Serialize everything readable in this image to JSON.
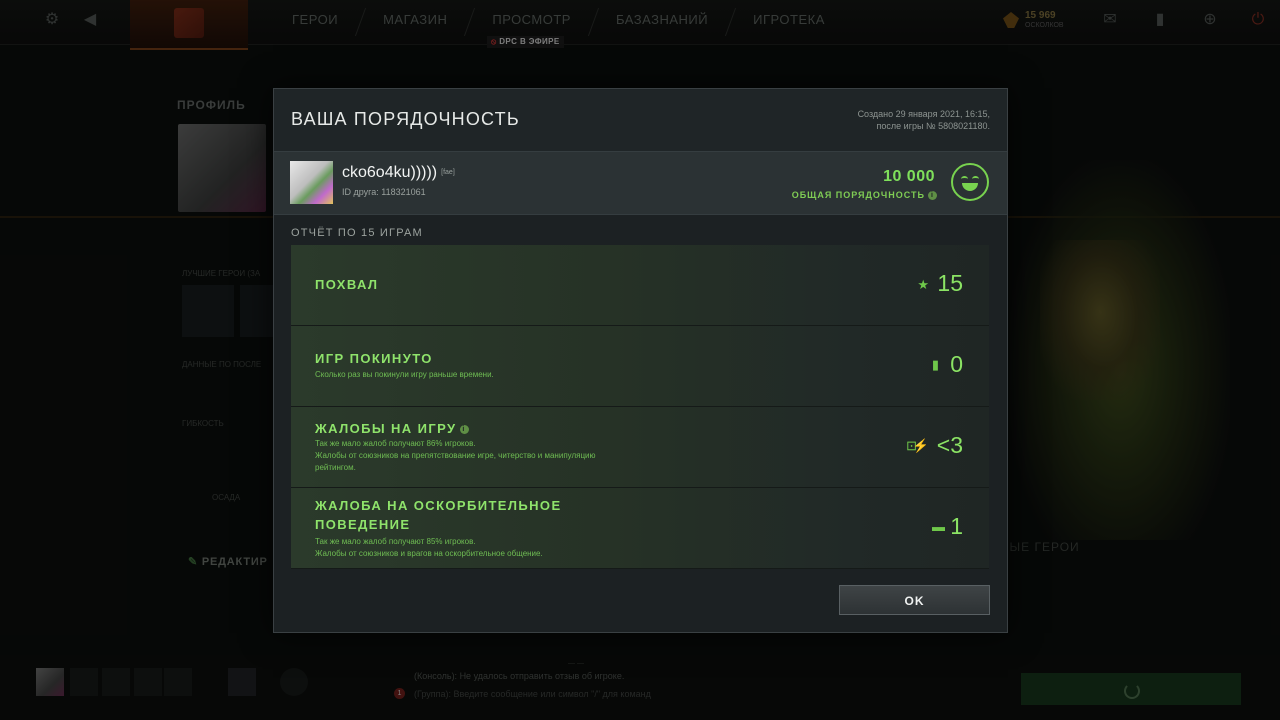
{
  "topnav": {
    "items": [
      "ГЕРОИ",
      "МАГАЗИН",
      "ПРОСМОТР",
      "БАЗАЗНАНИЙ",
      "ИГРОТЕКА"
    ],
    "live_badge": "DPC В ЭФИРЕ",
    "shards_value": "15 969",
    "shards_label": "ОСКОЛКОВ"
  },
  "background": {
    "profile_title": "ПРОФИЛЬ",
    "best_heroes_label": "ЛУЧШИЕ ГЕРОИ (ЗА",
    "recent_data_label": "ДАННЫЕ ПО ПОСЛЕ",
    "agility_label": "ГИБКОСТЬ",
    "siege_label": "ОСАДА",
    "edit_label": "РЕДАКТИР",
    "fav_heroes_label": "ЛЮБИМЫЕ ГЕРОИ"
  },
  "modal": {
    "title": "ВАША ПОРЯДОЧНОСТЬ",
    "created_line1": "Создано 29 января 2021, 16:15,",
    "created_line2": "после игры № 5808021180.",
    "player": {
      "name": "cko6o4ku)))))",
      "tag": "[fae]",
      "friend_id": "ID друга: 118321061"
    },
    "score": "10 000",
    "score_label": "ОБЩАЯ ПОРЯДОЧНОСТЬ",
    "report_title": "ОТЧЁТ ПО 15 ИГРАМ",
    "cards": [
      {
        "title": "ПОХВАЛ",
        "desc1": "",
        "desc2": "",
        "value": "15",
        "icon": "star-icon"
      },
      {
        "title": "ИГР ПОКИНУТО",
        "desc1": "Сколько раз вы покинули игру раньше времени.",
        "desc2": "",
        "value": "0",
        "icon": "exit-icon"
      },
      {
        "title": "ЖАЛОБЫ НА ИГРУ",
        "desc1": "Так же мало жалоб получают 86% игроков.",
        "desc2": "Жалобы от союзников на препятствование игре, читерство и манипуляцию рейтингом.",
        "value": "<3",
        "icon": "lock-icon"
      },
      {
        "title": "ЖАЛОБА НА ОСКОРБИТЕЛЬНОЕ ПОВЕДЕНИЕ",
        "desc1": "Так же мало жалоб получают 85% игроков.",
        "desc2": "Жалобы от союзников и врагов на оскорбительное общение.",
        "value": "1",
        "icon": "chat-icon"
      }
    ],
    "ok_label": "OK"
  },
  "bottom": {
    "chat_console": "(Консоль): Не удалось отправить отзыв об игроке.",
    "chat_group": "(Группа): Введите сообщение или символ \"/\" для команд",
    "chat_badge": "1"
  },
  "colors": {
    "accent_green": "#8be364",
    "modal_bg": "#1c2123",
    "card_bg": "#2b3a2b"
  }
}
